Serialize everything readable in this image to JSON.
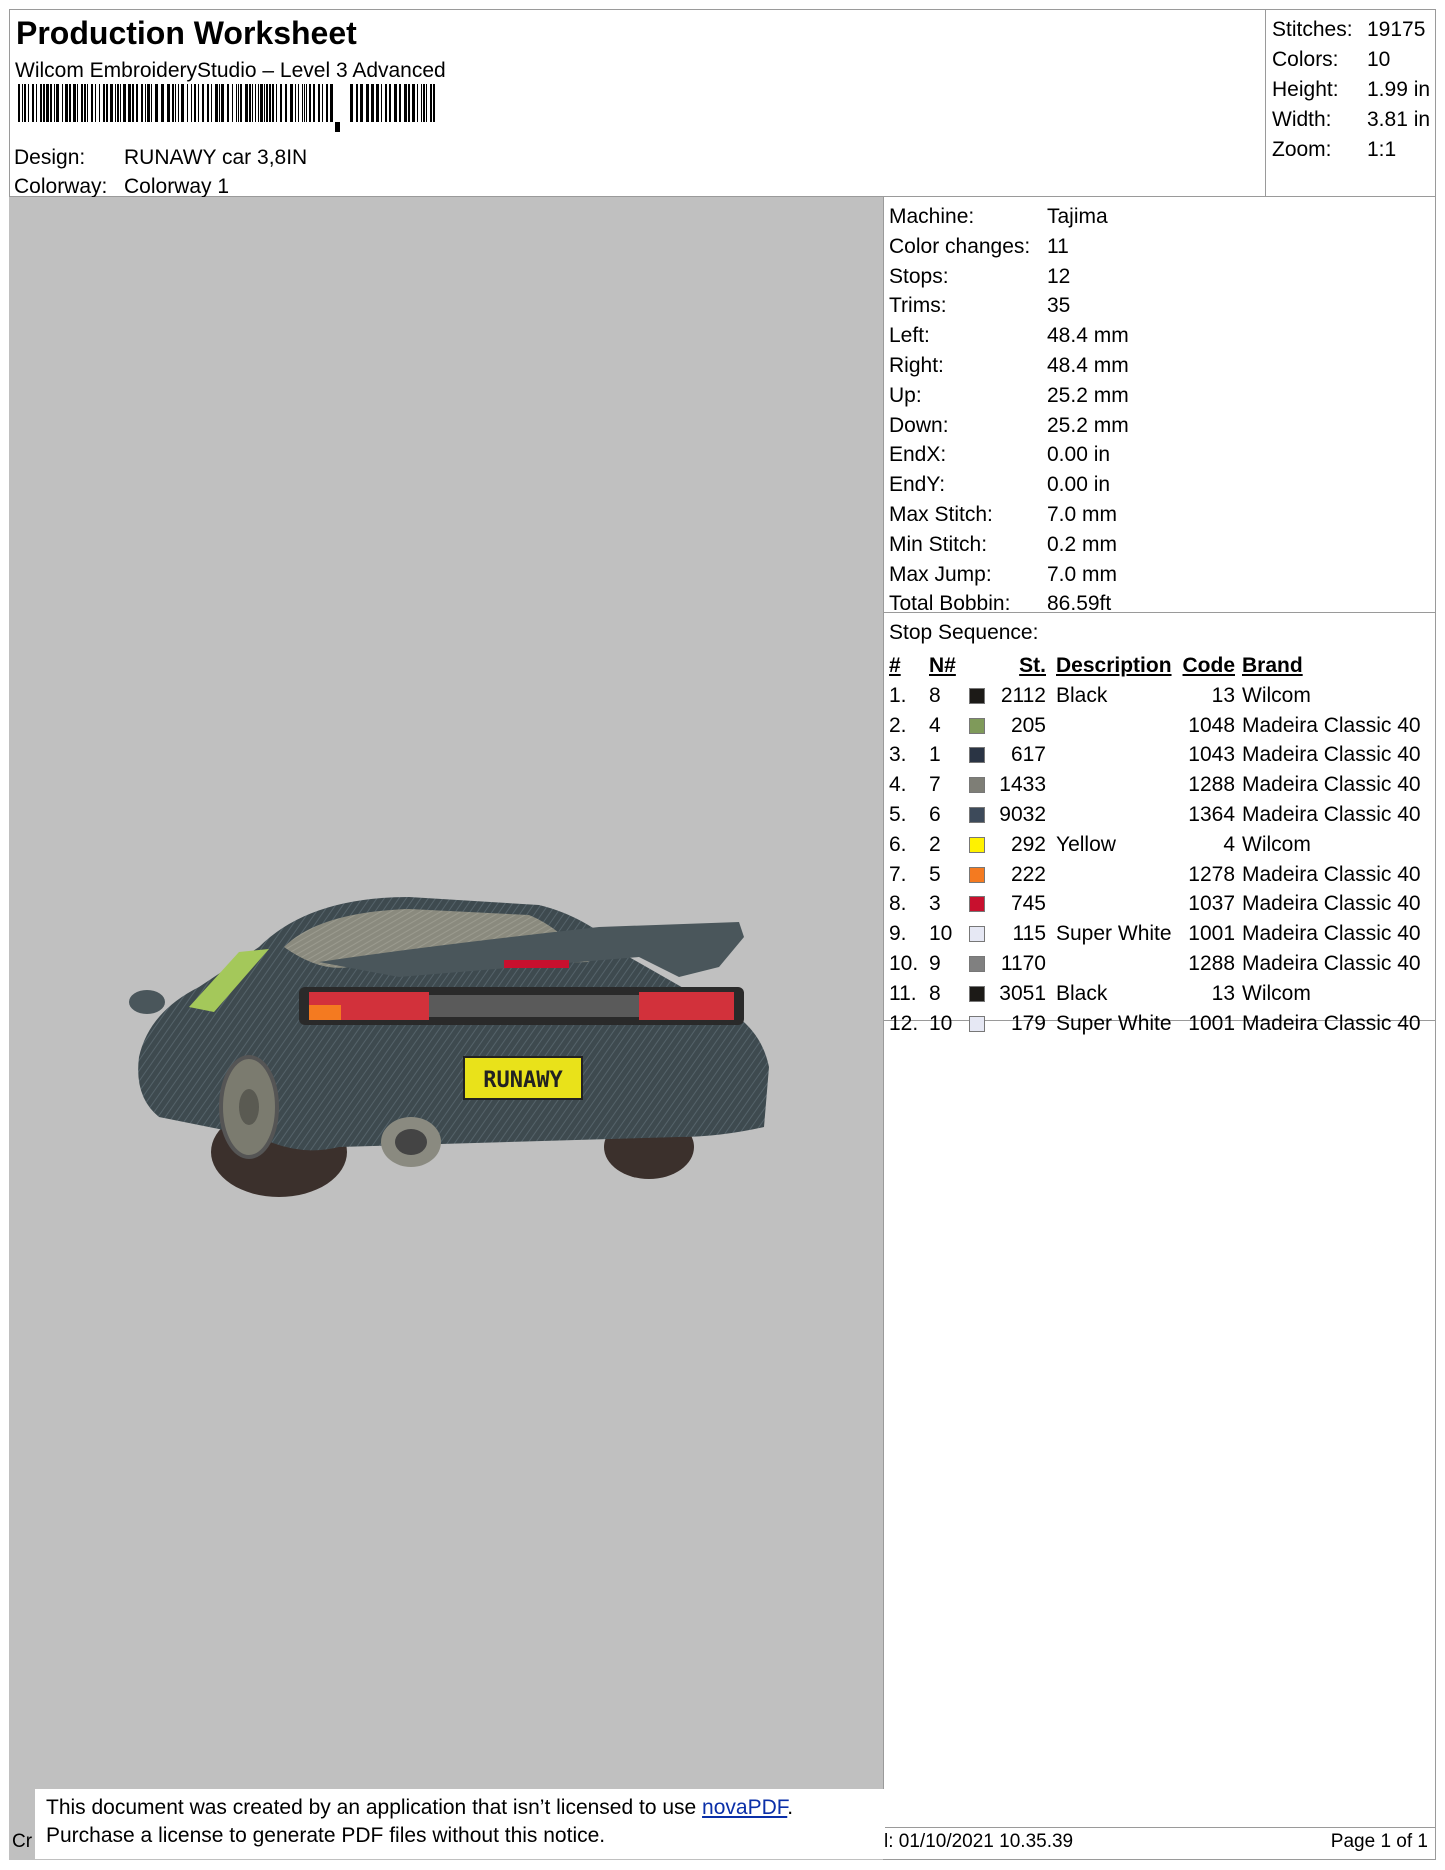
{
  "header": {
    "title": "Production Worksheet",
    "software": "Wilcom EmbroideryStudio – Level 3 Advanced",
    "design_label": "Design:",
    "design_value": "RUNAWY car 3,8IN",
    "colorway_label": "Colorway:",
    "colorway_value": "Colorway 1"
  },
  "stats": [
    {
      "label": "Stitches:",
      "value": "19175"
    },
    {
      "label": "Colors:",
      "value": "10"
    },
    {
      "label": "Height:",
      "value": "1.99 in"
    },
    {
      "label": "Width:",
      "value": "3.81 in"
    },
    {
      "label": "Zoom:",
      "value": "1:1"
    }
  ],
  "machine_info": [
    {
      "label": "Machine:",
      "value": "Tajima"
    },
    {
      "label": "Color changes:",
      "value": "11"
    },
    {
      "label": "Stops:",
      "value": "12"
    },
    {
      "label": "Trims:",
      "value": "35"
    },
    {
      "label": "Left:",
      "value": "48.4 mm"
    },
    {
      "label": "Right:",
      "value": "48.4 mm"
    },
    {
      "label": "Up:",
      "value": "25.2 mm"
    },
    {
      "label": "Down:",
      "value": "25.2 mm"
    },
    {
      "label": "EndX:",
      "value": "0.00 in"
    },
    {
      "label": "EndY:",
      "value": "0.00 in"
    },
    {
      "label": "Max Stitch:",
      "value": "7.0 mm"
    },
    {
      "label": "Min Stitch:",
      "value": "0.2 mm"
    },
    {
      "label": "Max Jump:",
      "value": "7.0 mm"
    },
    {
      "label": "Total Bobbin:",
      "value": "86.59ft"
    }
  ],
  "stop_sequence": {
    "label": "Stop Sequence:",
    "columns": {
      "idx": "#",
      "n": "N#",
      "st": "St.",
      "desc": "Description",
      "code": "Code",
      "brand": "Brand"
    },
    "rows": [
      {
        "idx": "1.",
        "n": "8",
        "color": "#1c1a17",
        "st": "2112",
        "desc": "Black",
        "code": "13",
        "brand": "Wilcom"
      },
      {
        "idx": "2.",
        "n": "4",
        "color": "#7f9a5a",
        "st": "205",
        "desc": "",
        "code": "1048",
        "brand": "Madeira Classic 40"
      },
      {
        "idx": "3.",
        "n": "1",
        "color": "#2a3444",
        "st": "617",
        "desc": "",
        "code": "1043",
        "brand": "Madeira Classic 40"
      },
      {
        "idx": "4.",
        "n": "7",
        "color": "#7e7e76",
        "st": "1433",
        "desc": "",
        "code": "1288",
        "brand": "Madeira Classic 40"
      },
      {
        "idx": "5.",
        "n": "6",
        "color": "#3d4a5a",
        "st": "9032",
        "desc": "",
        "code": "1364",
        "brand": "Madeira Classic 40"
      },
      {
        "idx": "6.",
        "n": "2",
        "color": "#fff200",
        "st": "292",
        "desc": "Yellow",
        "code": "4",
        "brand": "Wilcom"
      },
      {
        "idx": "7.",
        "n": "5",
        "color": "#f47a20",
        "st": "222",
        "desc": "",
        "code": "1278",
        "brand": "Madeira Classic 40"
      },
      {
        "idx": "8.",
        "n": "3",
        "color": "#c8102e",
        "st": "745",
        "desc": "",
        "code": "1037",
        "brand": "Madeira Classic 40"
      },
      {
        "idx": "9.",
        "n": "10",
        "color": "#e6e8f4",
        "st": "115",
        "desc": "Super White",
        "code": "1001",
        "brand": "Madeira Classic 40"
      },
      {
        "idx": "10.",
        "n": "9",
        "color": "#808080",
        "st": "1170",
        "desc": "",
        "code": "1288",
        "brand": "Madeira Classic 40"
      },
      {
        "idx": "11.",
        "n": "8",
        "color": "#1c1a17",
        "st": "3051",
        "desc": "Black",
        "code": "13",
        "brand": "Wilcom"
      },
      {
        "idx": "12.",
        "n": "10",
        "color": "#e6e8f4",
        "st": "179",
        "desc": "Super White",
        "code": "1001",
        "brand": "Madeira Classic 40"
      }
    ]
  },
  "design_preview": {
    "plate_text": "RUNAWY",
    "colors": {
      "background": "#c0c0c0",
      "body": "#3e4a4f",
      "glass": "#8a8a7e",
      "plate": "#e9e21a",
      "taillight": "#d2313b"
    }
  },
  "notice": {
    "line1_prefix": "This document was created by an application that isn’t licensed to use ",
    "link": "novaPDF",
    "line1_suffix": ".",
    "line2": "Purchase a license to generate PDF files without this notice."
  },
  "footer": {
    "left": "Cr",
    "date": "l: 01/10/2021 10.35.39",
    "page": "Page 1 of 1"
  }
}
